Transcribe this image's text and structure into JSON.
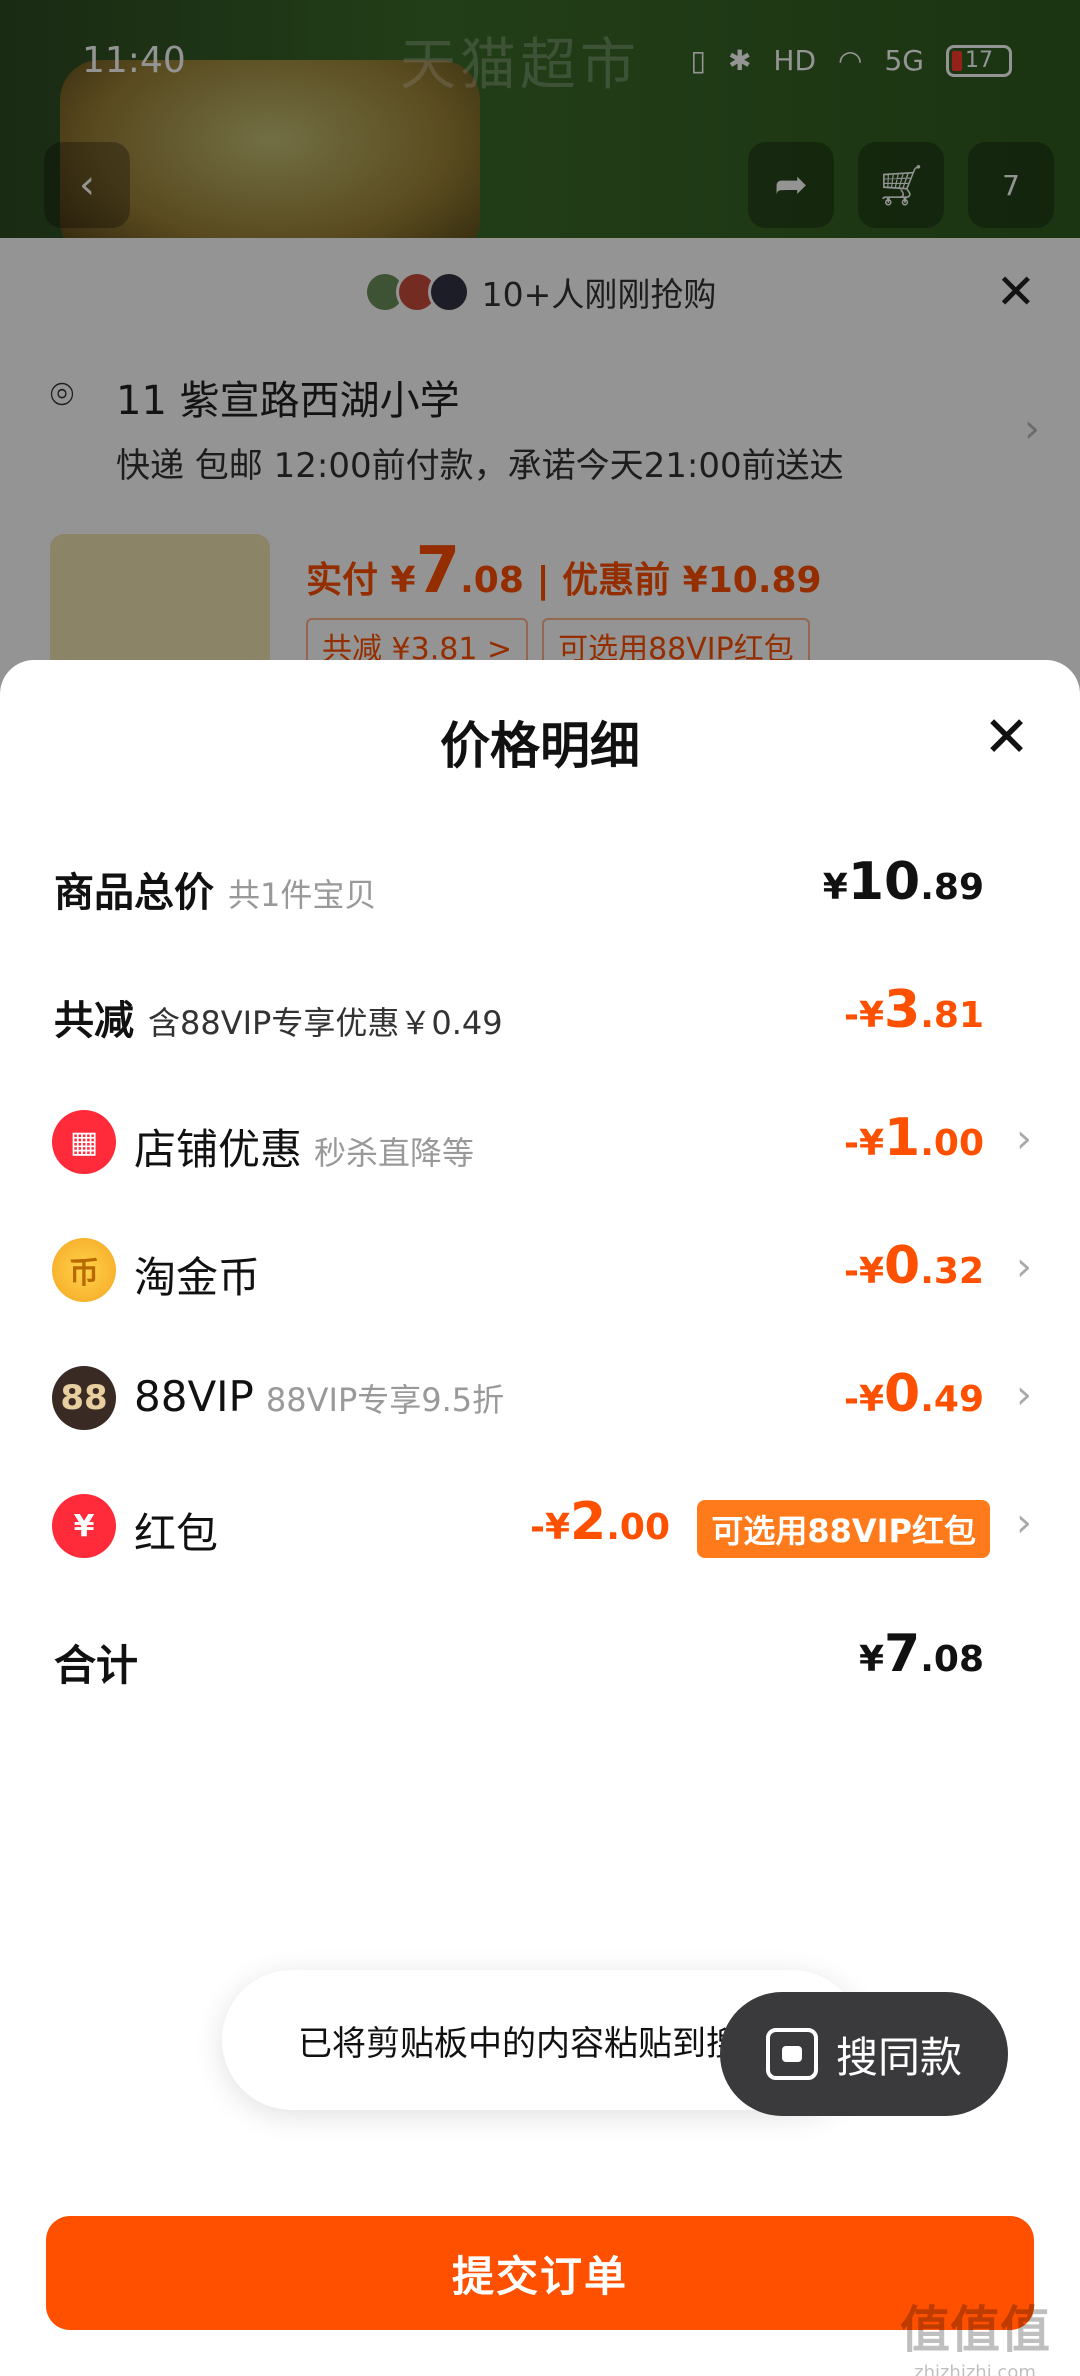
{
  "status_bar": {
    "time": "11:40",
    "network": "5G",
    "hd": "HD",
    "battery": "17"
  },
  "background_page": {
    "header_title": "天猫超市",
    "cart_badge": "7",
    "grab_text": "10+人刚刚抢购",
    "address": {
      "line1": "11 紫宣路西湖小学",
      "line2": "快递 包邮 12:00前付款，承诺今天21:00前送达"
    },
    "product": {
      "price_label": "实付 ¥",
      "price_int": "7",
      "price_dec": ".08",
      "before_label": "| 优惠前 ¥10.89",
      "tag_reduce": "共减 ¥3.81 >",
      "tag_vip": "可选用88VIP红包"
    }
  },
  "sheet": {
    "title": "价格明细",
    "rows": {
      "total_price": {
        "label": "商品总价",
        "sub": "共1件宝贝",
        "cur": "¥",
        "int": "10",
        "dec": ".89"
      },
      "reduce": {
        "label": "共减",
        "sub": "含88VIP专享优惠￥0.49",
        "cur": "-¥",
        "int": "3",
        "dec": ".81"
      },
      "store": {
        "label": "店铺优惠",
        "sub": "秒杀直降等",
        "cur": "-¥",
        "int": "1",
        "dec": ".00"
      },
      "coin": {
        "label": "淘金币",
        "cur": "-¥",
        "int": "0",
        "dec": ".32",
        "icon_text": "币"
      },
      "vip": {
        "label": "88VIP",
        "sub": "88VIP专享9.5折",
        "cur": "-¥",
        "int": "0",
        "dec": ".49",
        "icon_text": "88"
      },
      "hongbao": {
        "label": "红包",
        "cur": "-¥",
        "int": "2",
        "dec": ".00",
        "pill": "可选用88VIP红包",
        "icon_text": "¥"
      },
      "sum": {
        "label": "合计",
        "cur": "¥",
        "int": "7",
        "dec": ".08"
      }
    }
  },
  "toast": {
    "text": "已将剪贴板中的内容粘贴到搜"
  },
  "search_same": {
    "label": "搜同款"
  },
  "submit": {
    "label": "提交订单"
  },
  "watermark": {
    "line1": "值值值",
    "line2": "zhizhizhi.com"
  },
  "colors": {
    "accent": "#ff5000",
    "pill": "#ff7a1a"
  }
}
